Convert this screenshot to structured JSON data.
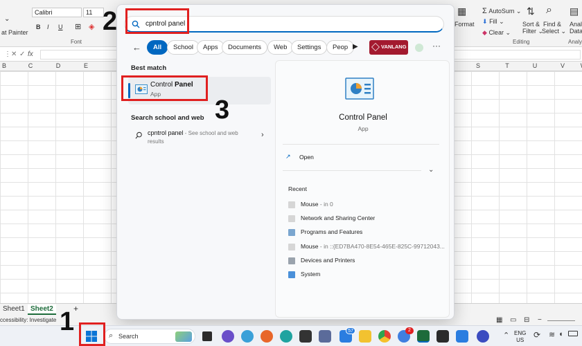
{
  "excel": {
    "font_name": "Calibri",
    "font_size": "11",
    "format_painter": "at Painter",
    "font_group": "Font",
    "bold": "B",
    "italic": "I",
    "underline": "U",
    "cell_ref": "",
    "fx": "fx",
    "columns_left": [
      "B",
      "C",
      "D",
      "E"
    ],
    "columns_right": [
      "S",
      "T",
      "U",
      "V",
      "W"
    ],
    "format_label": "Format",
    "autosum": "AutoSum",
    "fill": "Fill",
    "clear": "Clear",
    "sort_filter": "Sort &",
    "sort_filter2": "Filter",
    "find_select": "Find &",
    "find_select2": "Select",
    "analyze": "Analy",
    "analyze2": "Data",
    "editing_group": "Editing",
    "analysis_group": "Analy",
    "sheets": [
      "Sheet1",
      "Sheet2"
    ],
    "add_sheet": "+",
    "accessibility": "ccessibility: Investigate"
  },
  "search": {
    "query": "cpntrol panel",
    "filters": [
      "All",
      "School",
      "Apps",
      "Documents",
      "Web",
      "Settings",
      "Peop"
    ],
    "vanlang_label": "VANLANG"
  },
  "best_match": {
    "title": "Best match",
    "name_prefix": "Control ",
    "name_bold": "Panel",
    "type": "App"
  },
  "school_web": {
    "title": "Search school and web",
    "query": "cpntrol panel",
    "note": " - See school and web",
    "note2": "results"
  },
  "preview": {
    "name": "Control Panel",
    "type": "App",
    "open": "Open",
    "recent_title": "Recent",
    "recent": [
      {
        "label": "Mouse",
        "sub": " - in 0"
      },
      {
        "label": "Network and Sharing Center",
        "sub": ""
      },
      {
        "label": "Programs and Features",
        "sub": ""
      },
      {
        "label": "Mouse",
        "sub": " - in ::{ED7BA470-8E54-465E-825C-99712043..."
      },
      {
        "label": "Devices and Printers",
        "sub": ""
      },
      {
        "label": "System",
        "sub": ""
      }
    ]
  },
  "taskbar": {
    "search_label": "Search",
    "badge_a": "57",
    "badge_b": "2",
    "lang_top": "ENG",
    "lang_bottom": "US"
  },
  "annotations": {
    "step1": "1",
    "step2": "2",
    "step3": "3"
  },
  "colors": {
    "accent": "#0067c0",
    "annotation": "#e02020"
  }
}
